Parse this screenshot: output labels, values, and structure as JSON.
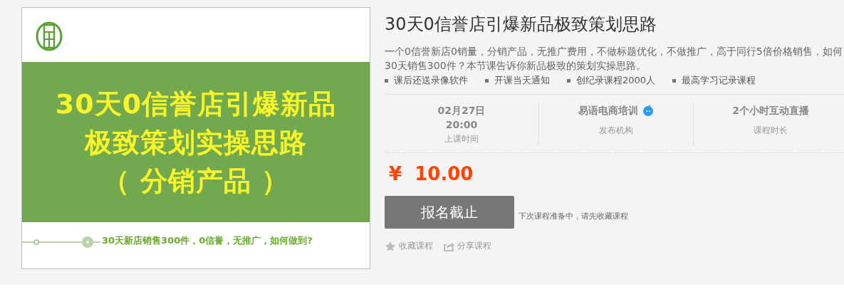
{
  "cover": {
    "headline_lines": [
      "30天0信誉店引爆新品",
      "极致策划实操思路",
      "（ 分销产品 ）"
    ],
    "tagline": "30天新店销售300件，0信誉，无推广，如何做到?"
  },
  "title": "30天0信誉店引爆新品极致策划思路",
  "description_lines": [
    "一个0信誉新店0销量，分销产品，无推广费用，不做标题优化，不做推广，高于同行5倍价格销售，如何",
    "30天销售300件？本节课告诉你新品极致的策划实操思路。"
  ],
  "features": [
    "课后还送录像软件",
    "开课当天通知",
    "创纪录课程2000人",
    "最高学习记录课程"
  ],
  "stats": [
    {
      "kind": "datetime",
      "value_lines": [
        "02月27日",
        "20:00"
      ],
      "label": "上课时间"
    },
    {
      "kind": "publisher",
      "value_lines": [
        "易语电商培训"
      ],
      "label": "发布机构",
      "verified": true
    },
    {
      "kind": "duration",
      "value_lines": [
        "2个小时互动直播"
      ],
      "label": "课程时长"
    }
  ],
  "price": {
    "symbol": "¥",
    "amount": "10.00"
  },
  "signup": {
    "label": "报名截止",
    "disabled": true,
    "note": "下次课程准备中，请先收藏课程"
  },
  "actions": [
    {
      "kind": "favorite",
      "label": "收藏课程"
    },
    {
      "kind": "share",
      "label": "分享课程"
    }
  ]
}
